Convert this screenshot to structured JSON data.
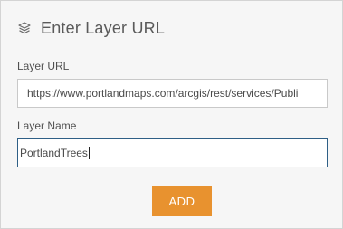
{
  "header": {
    "title": "Enter Layer URL",
    "icon": "layers-icon"
  },
  "layer_url": {
    "label": "Layer URL",
    "value": "https://www.portlandmaps.com/arcgis/rest/services/Publi"
  },
  "layer_name": {
    "label": "Layer Name",
    "value": "PortlandTrees"
  },
  "add_button": {
    "label": "ADD",
    "color": "#e8922f"
  }
}
